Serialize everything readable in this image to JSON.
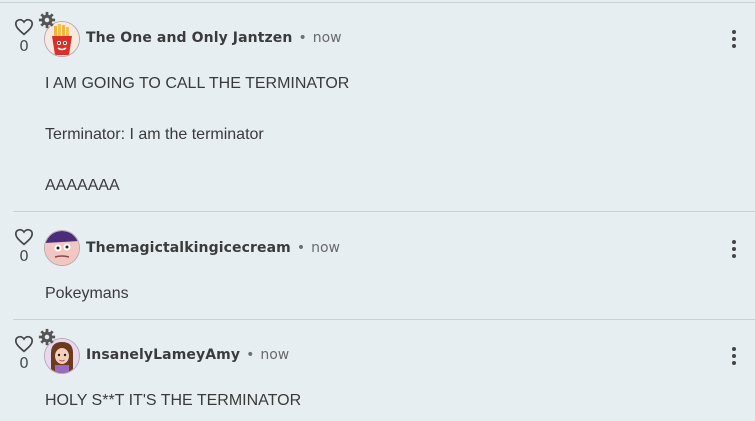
{
  "comments": [
    {
      "username": "The One and Only Jantzen",
      "separator": "•",
      "time": "now",
      "likes": "0",
      "lines": [
        "I AM GOING TO CALL THE TERMINATOR",
        "Terminator: I am the terminator",
        "AAAAAAA"
      ],
      "avatar": "fries-icon",
      "has_gear_badge": true
    },
    {
      "username": "Themagictalkingicecream",
      "separator": "•",
      "time": "now",
      "likes": "0",
      "lines": [
        "Pokeymans"
      ],
      "avatar": "cartoon-face-icon",
      "has_gear_badge": false
    },
    {
      "username": "InsanelyLameyAmy",
      "separator": "•",
      "time": "now",
      "likes": "0",
      "lines": [
        "HOLY S**T IT'S THE TERMINATOR"
      ],
      "avatar": "girl-portrait-icon",
      "has_gear_badge": true
    }
  ],
  "colors": {
    "background": "#e6eef2",
    "divider": "#c9d2d7",
    "text": "#3a3a3a"
  }
}
